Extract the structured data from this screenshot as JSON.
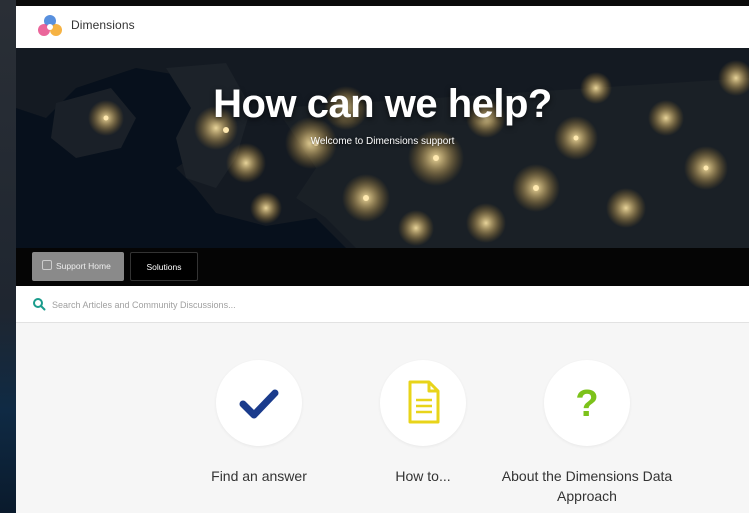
{
  "header": {
    "brand": "Dimensions",
    "logo_icon": "dimensions-logo-icon"
  },
  "hero": {
    "title": "How can we help?",
    "subtitle": "Welcome to Dimensions support"
  },
  "tabs": [
    {
      "label": "Support Home",
      "active": true
    },
    {
      "label": "Solutions",
      "active": false
    }
  ],
  "search": {
    "placeholder": "Search Articles and Community Discussions...",
    "icon": "search-icon",
    "accent": "#1a9c8c"
  },
  "cards": [
    {
      "label": "Find an answer",
      "icon": "checkmark-icon",
      "color": "#1a3b8c"
    },
    {
      "label": "How to...",
      "icon": "document-icon",
      "color": "#e8d41a"
    },
    {
      "label": "About the Dimensions Data Approach",
      "icon": "question-mark-icon",
      "color": "#7cc21a"
    }
  ]
}
